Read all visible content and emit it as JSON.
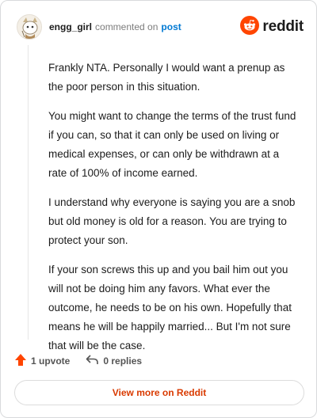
{
  "comment": {
    "username": "engg_girl",
    "action_text": "commented on",
    "post_link": "post",
    "brand": "reddit",
    "paragraphs": [
      "Frankly NTA. Personally I would want a prenup as the poor person in this situation.",
      "You might want to change the terms of the trust fund if you can, so that it can only be used on living or medical expenses, or can only be withdrawn at a rate of 100% of income earned.",
      "I understand why everyone is saying you are a snob but old money is old for a reason. You are trying to protect your son.",
      "If your son screws this up and you bail him out you will not be doing him any favors. What ever the outcome, he needs to be on his own. Hopefully that means he will be happily married... But I'm not sure that will be the case."
    ],
    "upvotes": "1 upvote",
    "replies": "0 replies",
    "view_more": "View more on Reddit"
  },
  "colors": {
    "brand": "#ff4500",
    "link": "#0079d3",
    "view_more": "#d93a00"
  },
  "icons": {
    "avatar": "avatar-icon",
    "logo": "reddit-logo-icon",
    "upvote": "upvote-arrow-icon",
    "reply": "reply-icon"
  }
}
